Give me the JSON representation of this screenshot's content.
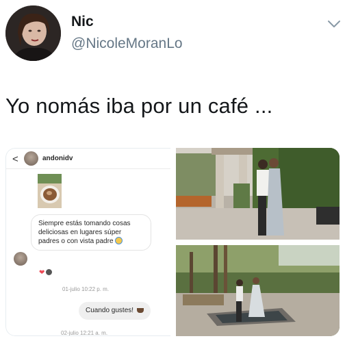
{
  "tweet": {
    "display_name": "Nic",
    "handle": "@NicoleMoranLo",
    "text": "Yo nomás iba por un café ...",
    "avatar_icon": "user-avatar",
    "menu_icon": "chevron-down-icon"
  },
  "dm": {
    "back_icon": "<",
    "username": "andonidv",
    "icons": [
      "video-icon",
      "flag-icon",
      "info-icon"
    ],
    "message": "Siempre estás tomando cosas deliciosas en lugares súper padres o con vista padre",
    "reactions": [
      "heart-icon"
    ],
    "time1": "01-julio 10:22 p. m.",
    "reply": "Cuando gustes!",
    "time2": "02-julio 12:21 a. m."
  },
  "colors": {
    "handle": "#657786",
    "text": "#14171a",
    "heart": "#ed4956"
  }
}
